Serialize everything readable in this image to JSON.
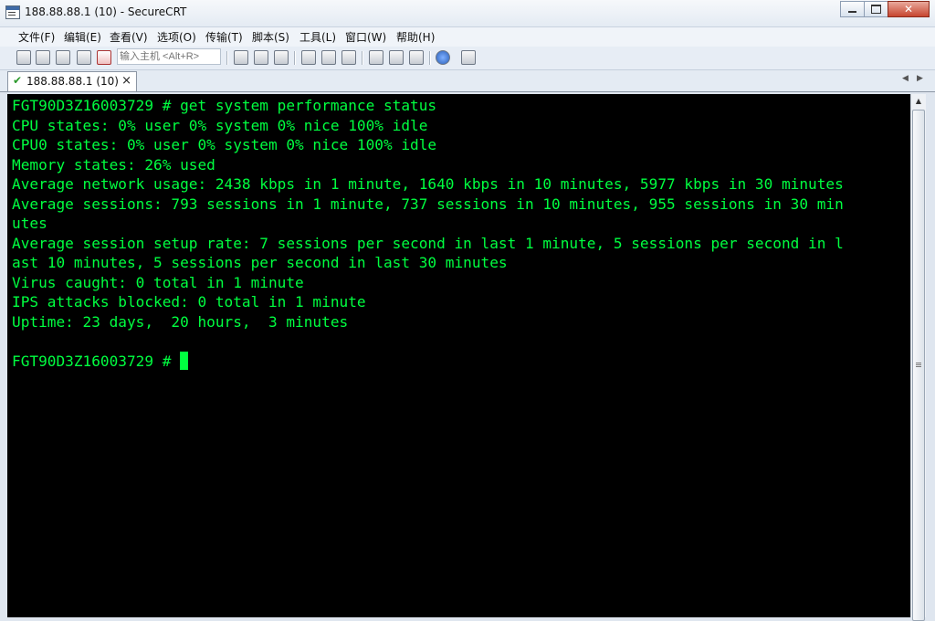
{
  "window": {
    "title": "188.88.88.1 (10) - SecureCRT"
  },
  "menu": [
    {
      "label": "文件(F)"
    },
    {
      "label": "编辑(E)"
    },
    {
      "label": "查看(V)"
    },
    {
      "label": "选项(O)"
    },
    {
      "label": "传输(T)"
    },
    {
      "label": "脚本(S)"
    },
    {
      "label": "工具(L)"
    },
    {
      "label": "窗口(W)"
    },
    {
      "label": "帮助(H)"
    }
  ],
  "toolbar": {
    "host_input_placeholder": "输入主机 <Alt+R>",
    "icons": [
      "connect-icon",
      "quick-connect-icon",
      "connect-tab-icon",
      "reconnect-icon",
      "disconnect-icon",
      "copy-icon",
      "paste-icon",
      "find-icon",
      "print-icon",
      "print-selection-icon",
      "print-screen-icon",
      "session-options-icon",
      "global-options-icon",
      "keymap-icon",
      "help-icon",
      "sftp-icon"
    ]
  },
  "tab": {
    "label": "188.88.88.1 (10)",
    "close": "×",
    "status_color": "#2b9a2b"
  },
  "terminal": {
    "text_color": "#00ff40",
    "lines": [
      "FGT90D3Z16003729 # get system performance status",
      "CPU states: 0% user 0% system 0% nice 100% idle",
      "CPU0 states: 0% user 0% system 0% nice 100% idle",
      "Memory states: 26% used",
      "Average network usage: 2438 kbps in 1 minute, 1640 kbps in 10 minutes, 5977 kbps in 30 minutes",
      "Average sessions: 793 sessions in 1 minute, 737 sessions in 10 minutes, 955 sessions in 30 min",
      "utes",
      "Average session setup rate: 7 sessions per second in last 1 minute, 5 sessions per second in l",
      "ast 10 minutes, 5 sessions per second in last 30 minutes",
      "Virus caught: 0 total in 1 minute",
      "IPS attacks blocked: 0 total in 1 minute",
      "Uptime: 23 days,  20 hours,  3 minutes",
      ""
    ],
    "prompt": "FGT90D3Z16003729 # "
  }
}
